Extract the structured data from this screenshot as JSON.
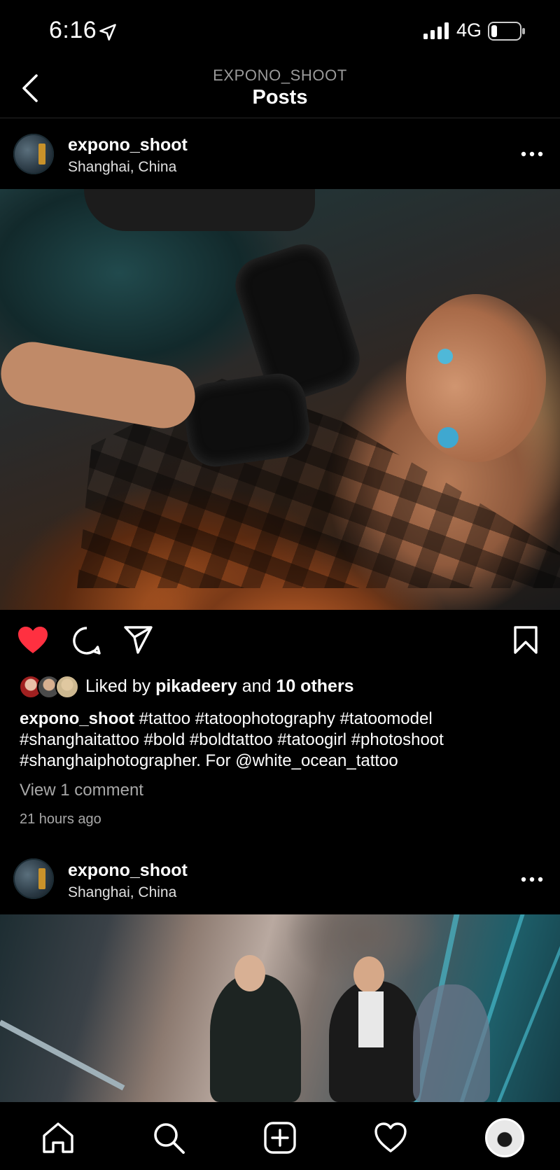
{
  "status_bar": {
    "time": "6:16",
    "network": "4G"
  },
  "header": {
    "account": "EXPONO_SHOOT",
    "title": "Posts"
  },
  "posts": [
    {
      "username": "expono_shoot",
      "location": "Shanghai, China",
      "liked": true,
      "likes": {
        "prefix": "Liked by ",
        "user": "pikadeery",
        "middle": " and ",
        "others": "10 others"
      },
      "caption": {
        "username": "expono_shoot",
        "text": " #tattoo #tatoophotography #tatoomodel #shanghaitattoo #bold #boldtattoo #tatoogirl #photoshoot #shanghaiphotographer. For @white_ocean_tattoo"
      },
      "view_comments": "View 1 comment",
      "time_ago": "21 hours ago"
    },
    {
      "username": "expono_shoot",
      "location": "Shanghai, China"
    }
  ],
  "colors": {
    "background": "#000000",
    "like_red": "#ff3040",
    "secondary_text": "#a8a8a8"
  },
  "icons": {
    "back": "chevron-left-icon",
    "more": "more-horizontal-icon",
    "like": "heart-icon",
    "comment": "comment-icon",
    "share": "send-icon",
    "save": "bookmark-icon",
    "nav": [
      "home-icon",
      "search-icon",
      "add-post-icon",
      "activity-heart-icon",
      "profile-avatar"
    ]
  }
}
